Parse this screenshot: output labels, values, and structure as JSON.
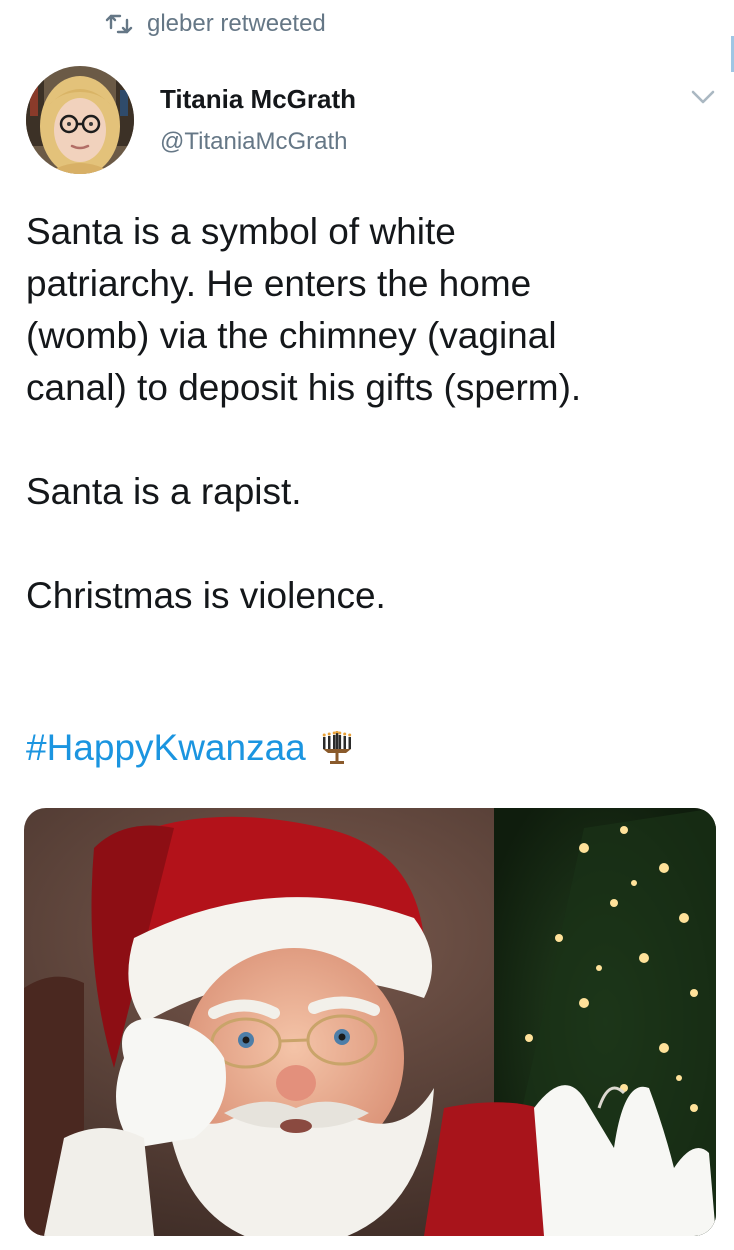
{
  "retweet": {
    "icon": "retweet-icon",
    "text": "gleber retweeted"
  },
  "author": {
    "name": "Titania McGrath",
    "handle": "@TitaniaMcGrath",
    "avatar": "avatar-photo"
  },
  "menu": {
    "icon": "chevron-down-icon"
  },
  "tweet": {
    "lines": [
      "Santa is a symbol of white",
      "patriarchy. He enters the home",
      "(womb) via the chimney (vaginal",
      "canal) to deposit his gifts (sperm).",
      "Santa is a rapist.",
      "Christmas is violence."
    ],
    "hashtag": "#HappyKwanzaa",
    "emoji": "kinara-candles-icon"
  },
  "colors": {
    "link": "#1b95e0",
    "muted": "#657786",
    "text": "#14171a"
  },
  "media": {
    "subject": "santa-claus-photo"
  }
}
